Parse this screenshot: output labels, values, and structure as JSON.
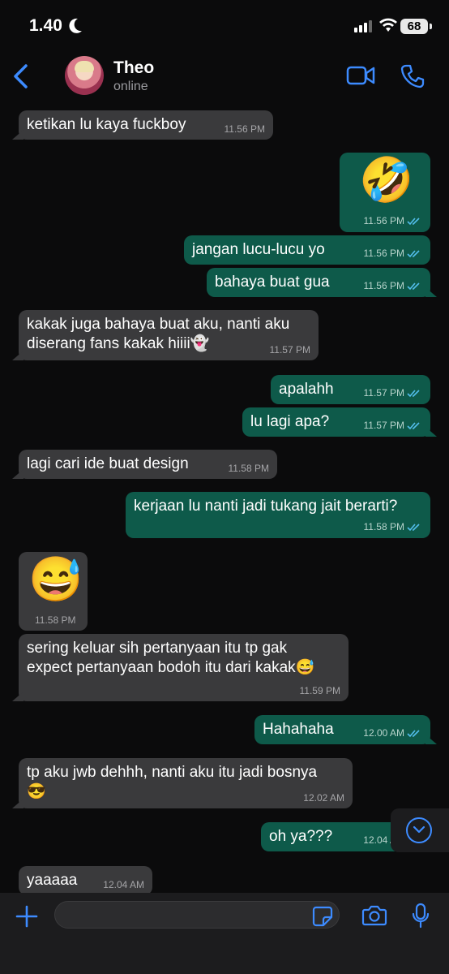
{
  "status_bar": {
    "time": "1.40",
    "battery": "68"
  },
  "header": {
    "name": "Theo",
    "status": "online"
  },
  "messages": [
    {
      "dir": "in",
      "text": "ketikan lu kaya fuckboy",
      "time": "11.56 PM"
    },
    {
      "dir": "out",
      "text": "🤣",
      "time": "11.56 PM",
      "emoji": true
    },
    {
      "dir": "out",
      "text": "jangan lucu-lucu yo",
      "time": "11.56 PM"
    },
    {
      "dir": "out",
      "text": "bahaya buat gua",
      "time": "11.56 PM"
    },
    {
      "dir": "in",
      "text": "kakak juga bahaya buat aku, nanti aku\ndiserang fans kakak hiiii👻",
      "time": "11.57 PM"
    },
    {
      "dir": "out",
      "text": "apalahh",
      "time": "11.57 PM"
    },
    {
      "dir": "out",
      "text": "lu lagi apa?",
      "time": "11.57 PM"
    },
    {
      "dir": "in",
      "text": "lagi cari ide buat design",
      "time": "11.58 PM"
    },
    {
      "dir": "out",
      "text": "kerjaan lu nanti jadi tukang jait berarti?",
      "time": "11.58 PM"
    },
    {
      "dir": "in",
      "text": "😅",
      "time": "11.58 PM",
      "emoji": true
    },
    {
      "dir": "in",
      "text": "sering keluar sih pertanyaan itu tp gak\nexpect pertanyaan bodoh itu dari kakak😅",
      "time": "11.59 PM"
    },
    {
      "dir": "out",
      "text": "Hahahaha",
      "time": "12.00 AM"
    },
    {
      "dir": "in",
      "text": "tp aku jwb dehhh, nanti aku itu jadi bosnya\n😎",
      "time": "12.02 AM"
    },
    {
      "dir": "out",
      "text": "oh ya???",
      "time": "12.04 AM"
    },
    {
      "dir": "in",
      "text": "yaaaaa",
      "time": "12.04 AM"
    }
  ],
  "composer": {
    "value": "",
    "placeholder": ""
  },
  "icons": {
    "back": "chevron-left-icon",
    "video": "video-camera-icon",
    "call": "phone-icon",
    "plus": "plus-icon",
    "sticker": "sticker-icon",
    "camera": "camera-icon",
    "mic": "microphone-icon",
    "scroll": "chevron-down-icon",
    "read": "double-check-icon"
  },
  "colors": {
    "accent": "#3d8bff",
    "incoming_bubble": "#3a3a3c",
    "outgoing_bubble": "#0e5a4a",
    "read_tick": "#53bdeb",
    "background": "#0b0b0c"
  }
}
